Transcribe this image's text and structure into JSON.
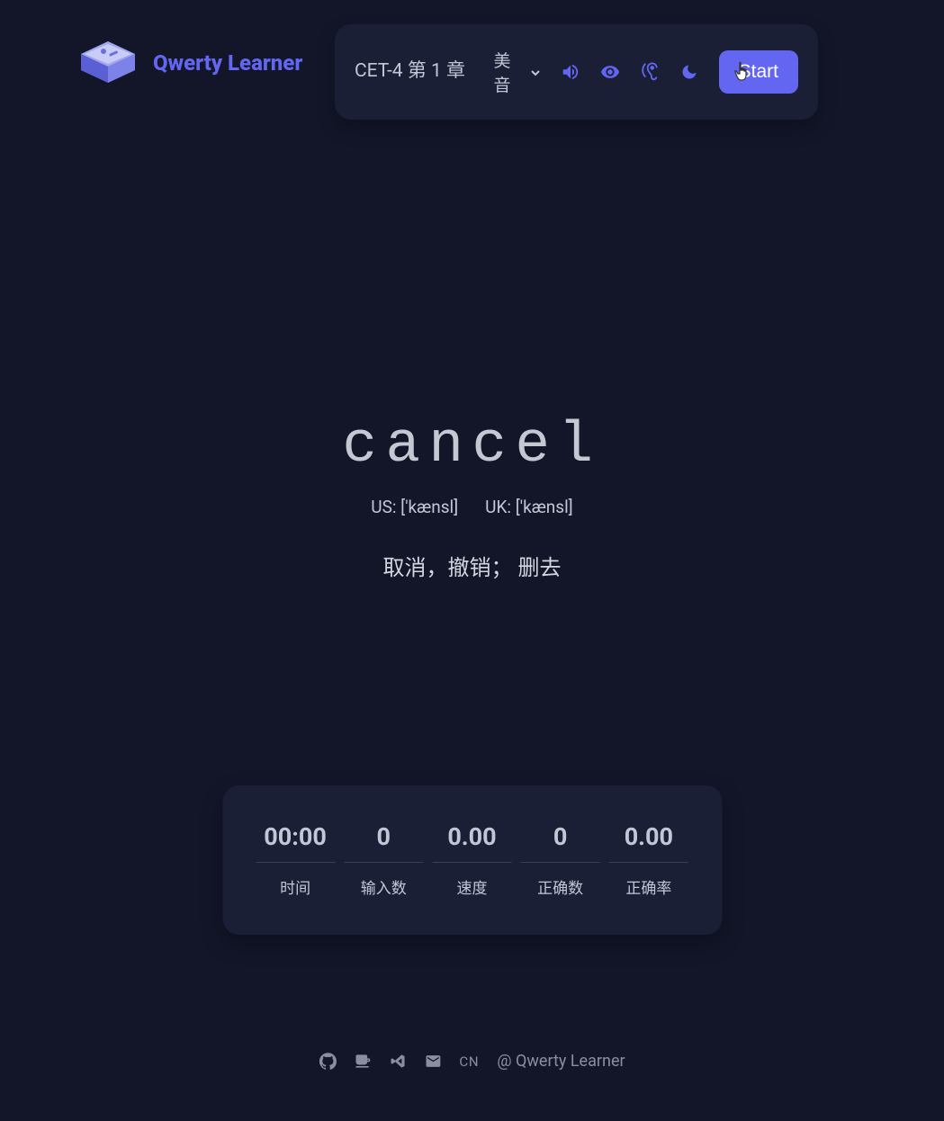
{
  "app": {
    "title": "Qwerty Learner"
  },
  "toolbar": {
    "chapter": "CET-4 第 1 章",
    "pronunciation": "美音",
    "start_label": "Start"
  },
  "main": {
    "word": "cancel",
    "phonetic_us": "US: ['kænsl]",
    "phonetic_uk": "UK: ['kænsl]",
    "translation": "取消，撤销； 删去"
  },
  "stats": {
    "time_value": "00:00",
    "time_label": "时间",
    "input_value": "0",
    "input_label": "输入数",
    "speed_value": "0.00",
    "speed_label": "速度",
    "correct_value": "0",
    "correct_label": "正确数",
    "accuracy_value": "0.00",
    "accuracy_label": "正确率"
  },
  "footer": {
    "cn": "CN",
    "copyright": "@ Qwerty Learner"
  }
}
